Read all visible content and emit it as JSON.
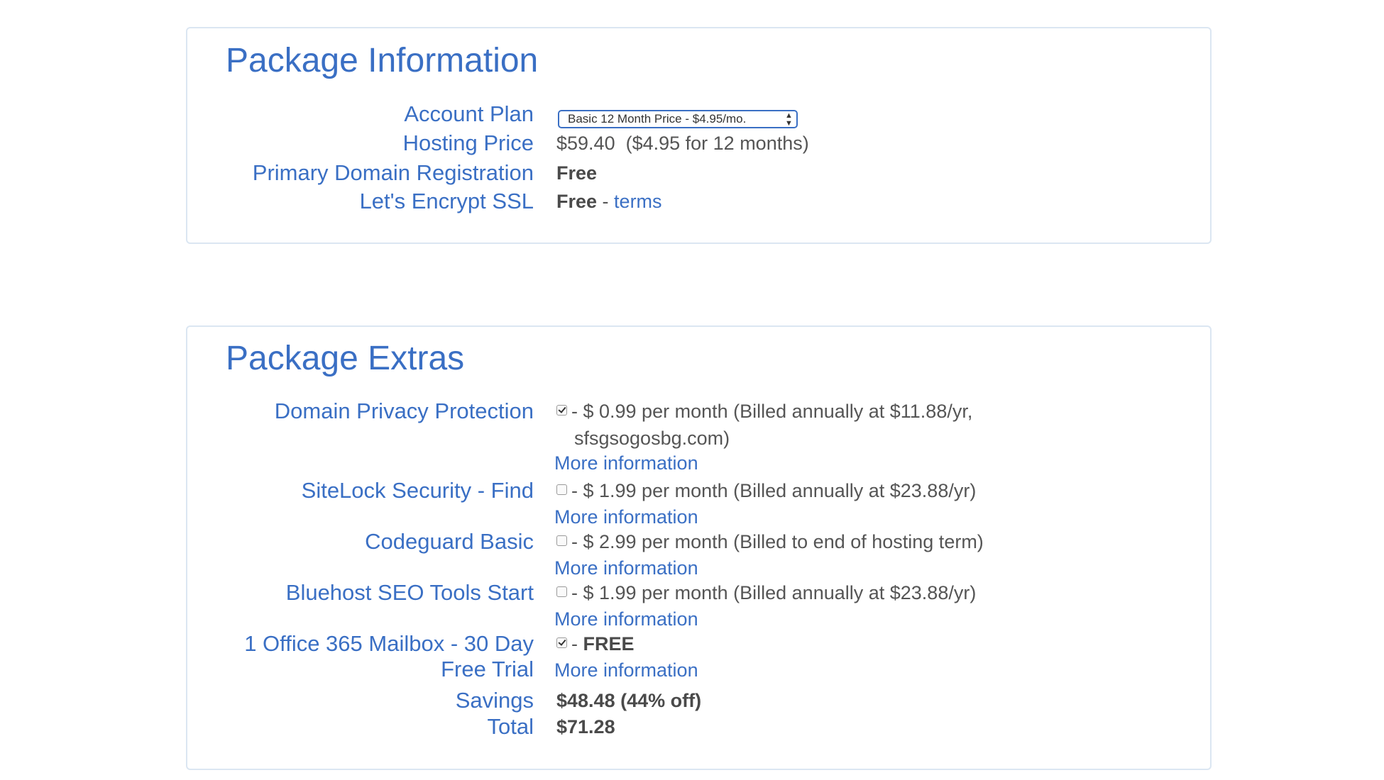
{
  "package_information": {
    "title": "Package Information",
    "account_plan": {
      "label": "Account Plan",
      "selected": "Basic 12 Month Price - $4.95/mo."
    },
    "hosting_price": {
      "label": "Hosting Price",
      "value": "$59.40  ($4.95 for 12 months)"
    },
    "primary_domain": {
      "label": "Primary Domain Registration",
      "value": "Free"
    },
    "ssl": {
      "label": "Let's Encrypt SSL",
      "value": "Free",
      "separator": " - ",
      "link": "terms"
    }
  },
  "package_extras": {
    "title": "Package Extras",
    "more_info_label": "More information",
    "items": [
      {
        "label": "Domain Privacy Protection",
        "checked": true,
        "price": "- $ 0.99 per month (Billed annually at $11.88/yr,",
        "price_cont": "sfsgsogosbg.com)"
      },
      {
        "label": "SiteLock Security - Find",
        "checked": false,
        "price": "- $ 1.99 per month (Billed annually at $23.88/yr)"
      },
      {
        "label": "Codeguard Basic",
        "checked": false,
        "price": "- $ 2.99 per month (Billed to end of hosting term)"
      },
      {
        "label": "Bluehost SEO Tools Start",
        "checked": false,
        "price": "- $ 1.99 per month (Billed annually at $23.88/yr)"
      },
      {
        "label": "1 Office 365 Mailbox - 30 Day Free Trial",
        "label_line1": "1 Office 365 Mailbox - 30 Day",
        "label_line2": "Free Trial",
        "checked": true,
        "price_prefix": "-",
        "price": "FREE"
      }
    ],
    "savings": {
      "label": "Savings",
      "value": "$48.48 (44% off)"
    },
    "total": {
      "label": "Total",
      "value": "$71.28"
    }
  }
}
